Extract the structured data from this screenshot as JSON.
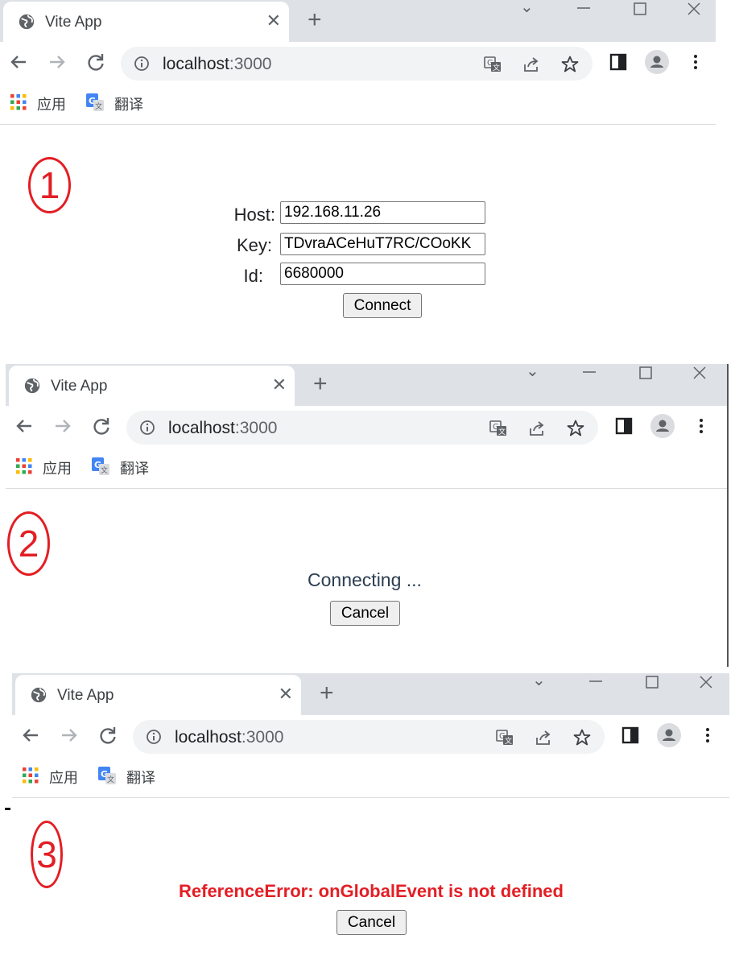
{
  "browser": {
    "tab_title": "Vite App",
    "url_host": "localhost",
    "url_port": ":3000",
    "bookmarks": [
      "应用",
      "翻译"
    ]
  },
  "steps": [
    {
      "marker": "1"
    },
    {
      "marker": "2"
    },
    {
      "marker": "3"
    }
  ],
  "form": {
    "host_label": "Host:",
    "host_value": "192.168.11.26",
    "key_label": "Key:",
    "key_value": "TDvraACeHuT7RC/COoKK",
    "id_label": "Id:",
    "id_value": "6680000",
    "connect_button": "Connect"
  },
  "connecting": {
    "status_text": "Connecting ...",
    "cancel_button": "Cancel"
  },
  "error_state": {
    "error_text": "ReferenceError: onGlobalEvent is not defined",
    "cancel_button": "Cancel"
  },
  "colors": {
    "annotation_red": "#e31e24",
    "error_red": "#e31e24",
    "tabstrip_bg": "#dee1e6",
    "omnibox_bg": "#f1f3f4"
  }
}
